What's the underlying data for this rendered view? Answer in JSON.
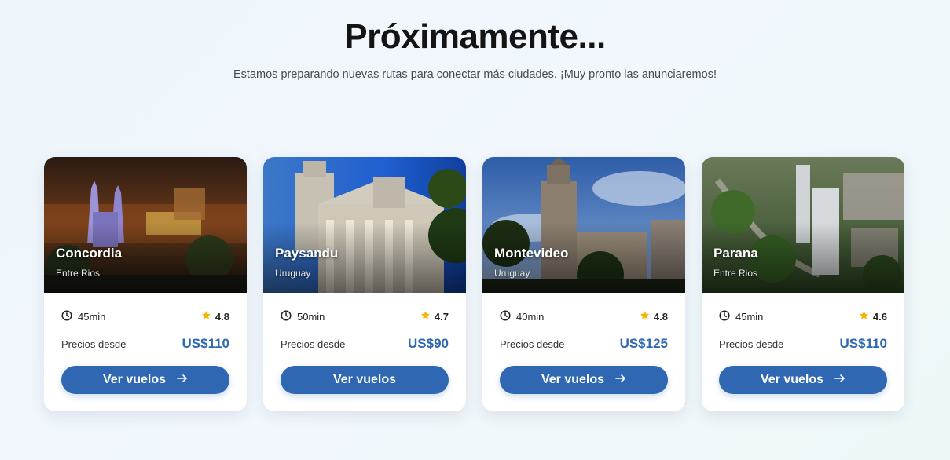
{
  "header": {
    "title": "Próximamente...",
    "subtitle": "Estamos preparando nuevas rutas para conectar más ciudades. ¡Muy pronto las anunciaremos!"
  },
  "colors": {
    "accent": "#2f67b2",
    "star": "#f5b400"
  },
  "cards": [
    {
      "city": "Concordia",
      "region": "Entre Rios",
      "duration": "45min",
      "rating": "4.8",
      "price_label": "Precios desde",
      "price": "US$110",
      "button": "Ver vuelos",
      "icons": [
        "clock-icon",
        "star-icon",
        "arrow-right-icon"
      ]
    },
    {
      "city": "Paysandu",
      "region": "Uruguay",
      "duration": "50min",
      "rating": "4.7",
      "price_label": "Precios desde",
      "price": "US$90",
      "button": "Ver vuelos",
      "icons": [
        "clock-icon",
        "star-icon"
      ]
    },
    {
      "city": "Montevideo",
      "region": "Uruguay",
      "duration": "40min",
      "rating": "4.8",
      "price_label": "Precios desde",
      "price": "US$125",
      "button": "Ver vuelos",
      "icons": [
        "clock-icon",
        "star-icon",
        "arrow-right-icon"
      ]
    },
    {
      "city": "Parana",
      "region": "Entre Rios",
      "duration": "45min",
      "rating": "4.6",
      "price_label": "Precios desde",
      "price": "US$110",
      "button": "Ver vuelos",
      "icons": [
        "clock-icon",
        "star-icon",
        "arrow-right-icon"
      ]
    }
  ]
}
